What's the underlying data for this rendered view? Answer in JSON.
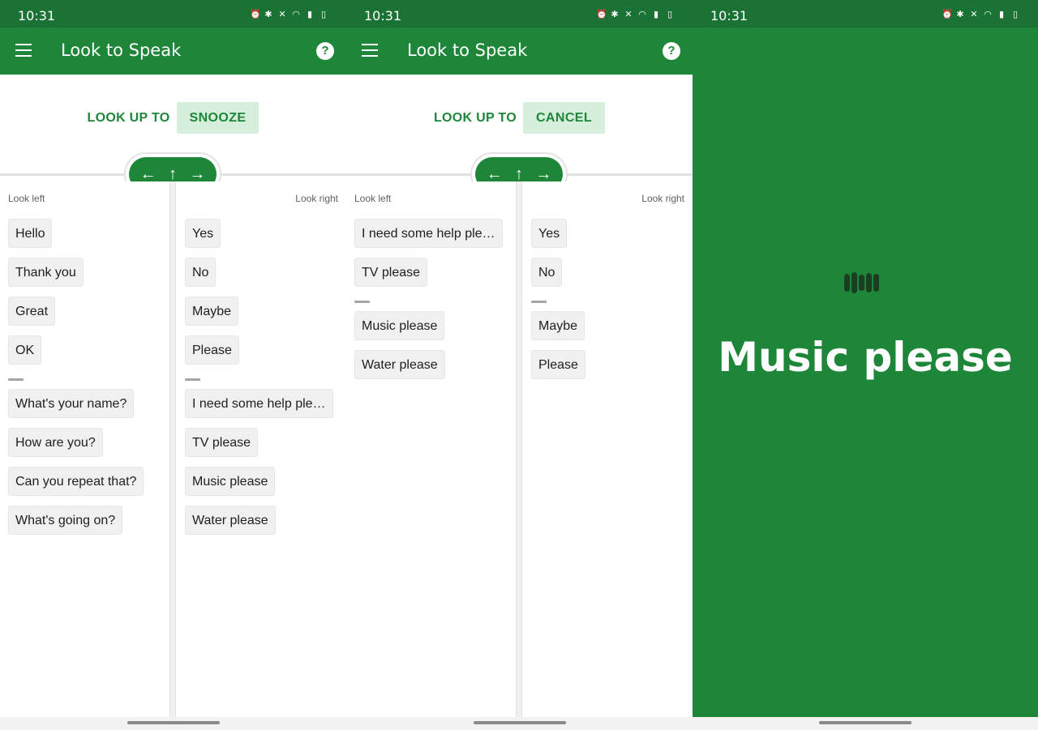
{
  "status_time": "10:31",
  "app_title": "Look to Speak",
  "screens": [
    {
      "lookup_label": "LOOK UP TO",
      "lookup_action": "SNOOZE",
      "left_label": "Look left",
      "right_label": "Look right",
      "left_top": [
        "Hello",
        "Thank you",
        "Great",
        "OK"
      ],
      "left_bottom": [
        "What's your name?",
        "How are you?",
        "Can you repeat that?",
        "What's going on?"
      ],
      "right_top": [
        "Yes",
        "No",
        "Maybe",
        "Please"
      ],
      "right_bottom": [
        "I need some help ple…",
        "TV please",
        "Music please",
        "Water please"
      ]
    },
    {
      "lookup_label": "LOOK UP TO",
      "lookup_action": "CANCEL",
      "left_label": "Look left",
      "right_label": "Look right",
      "left_top": [
        "I need some help ple…",
        "TV please"
      ],
      "left_bottom": [
        "Music please",
        "Water please"
      ],
      "right_top": [
        "Yes",
        "No"
      ],
      "right_bottom": [
        "Maybe",
        "Please"
      ]
    }
  ],
  "spoken_text": "Music please",
  "nav_arrows": {
    "left": "←",
    "up": "↑",
    "right": "→"
  },
  "help_glyph": "?",
  "colors": {
    "appbar": "#1e8639",
    "statusbar": "#1a7334",
    "accent_light": "#d6efdc"
  }
}
